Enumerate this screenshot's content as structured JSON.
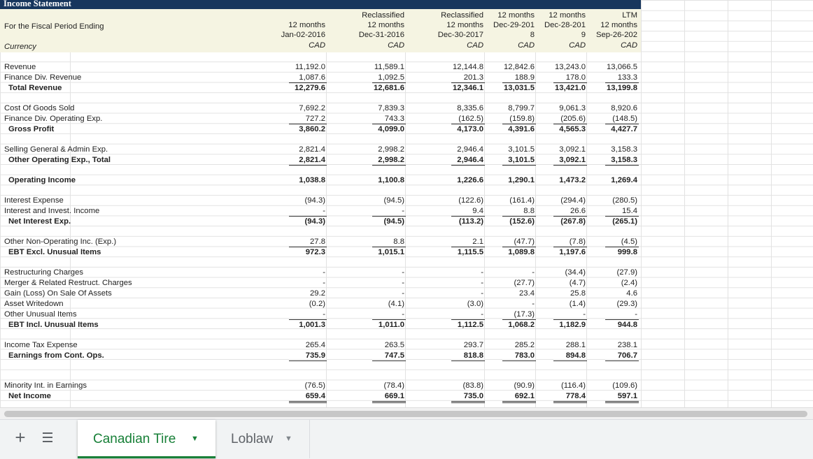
{
  "sheet": {
    "title": "Income Statement",
    "period_label": "For the Fiscal Period Ending",
    "currency_label": "Currency",
    "columns": [
      {
        "l1": "",
        "l2": "12 months",
        "l3": "Jan-02-2016",
        "cur": "CAD"
      },
      {
        "l1": "Reclassified",
        "l2": "12 months",
        "l3": "Dec-31-2016",
        "cur": "CAD"
      },
      {
        "l1": "Reclassified",
        "l2": "12 months",
        "l3": "Dec-30-2017",
        "cur": "CAD"
      },
      {
        "l1": "12 months",
        "l2": "Dec-29-201",
        "l3": "8",
        "cur": "CAD"
      },
      {
        "l1": "12 months",
        "l2": "Dec-28-201",
        "l3": "9",
        "cur": "CAD"
      },
      {
        "l1": "LTM",
        "l2": "12 months",
        "l3": "Sep-26-202",
        "cur": "CAD"
      }
    ],
    "rows": [
      {
        "label": "Revenue",
        "vals": [
          "11,192.0",
          "11,589.1",
          "12,144.8",
          "12,842.6",
          "13,243.0",
          "13,066.5"
        ]
      },
      {
        "label": "Finance Div. Revenue",
        "vals": [
          "1,087.6",
          "1,092.5",
          "201.3",
          "188.9",
          "178.0",
          "133.3"
        ]
      },
      {
        "label": "Total Revenue",
        "bold": true,
        "vals": [
          "12,279.6",
          "12,681.6",
          "12,346.1",
          "13,031.5",
          "13,421.0",
          "13,199.8"
        ]
      },
      {
        "label": "Cost Of Goods Sold",
        "vals": [
          "7,692.2",
          "7,839.3",
          "8,335.6",
          "8,799.7",
          "9,061.3",
          "8,920.6"
        ]
      },
      {
        "label": "Finance Div. Operating Exp.",
        "vals": [
          "727.2",
          "743.3",
          "(162.5)",
          "(159.8)",
          "(205.6)",
          "(148.5)"
        ]
      },
      {
        "label": "Gross Profit",
        "bold": true,
        "vals": [
          "3,860.2",
          "4,099.0",
          "4,173.0",
          "4,391.6",
          "4,565.3",
          "4,427.7"
        ]
      },
      {
        "label": "Selling General & Admin Exp.",
        "vals": [
          "2,821.4",
          "2,998.2",
          "2,946.4",
          "3,101.5",
          "3,092.1",
          "3,158.3"
        ]
      },
      {
        "label": "Other Operating Exp., Total",
        "bold": true,
        "vals": [
          "2,821.4",
          "2,998.2",
          "2,946.4",
          "3,101.5",
          "3,092.1",
          "3,158.3"
        ]
      },
      {
        "label": "Operating Income",
        "bold": true,
        "vals": [
          "1,038.8",
          "1,100.8",
          "1,226.6",
          "1,290.1",
          "1,473.2",
          "1,269.4"
        ]
      },
      {
        "label": "Interest Expense",
        "vals": [
          "(94.3)",
          "(94.5)",
          "(122.6)",
          "(161.4)",
          "(294.4)",
          "(280.5)"
        ]
      },
      {
        "label": "Interest and Invest. Income",
        "vals": [
          "-",
          "-",
          "9.4",
          "8.8",
          "26.6",
          "15.4"
        ]
      },
      {
        "label": "Net Interest Exp.",
        "bold": true,
        "vals": [
          "(94.3)",
          "(94.5)",
          "(113.2)",
          "(152.6)",
          "(267.8)",
          "(265.1)"
        ]
      },
      {
        "label": "Other Non-Operating Inc. (Exp.)",
        "vals": [
          "27.8",
          "8.8",
          "2.1",
          "(47.7)",
          "(7.8)",
          "(4.5)"
        ]
      },
      {
        "label": "EBT Excl. Unusual Items",
        "bold": true,
        "vals": [
          "972.3",
          "1,015.1",
          "1,115.5",
          "1,089.8",
          "1,197.6",
          "999.8"
        ]
      },
      {
        "label": "Restructuring Charges",
        "vals": [
          "-",
          "-",
          "-",
          "-",
          "(34.4)",
          "(27.9)"
        ]
      },
      {
        "label": "Merger & Related Restruct. Charges",
        "vals": [
          "-",
          "-",
          "-",
          "(27.7)",
          "(4.7)",
          "(2.4)"
        ]
      },
      {
        "label": "Gain (Loss) On Sale Of Assets",
        "vals": [
          "29.2",
          "-",
          "-",
          "23.4",
          "25.8",
          "4.6"
        ]
      },
      {
        "label": "Asset Writedown",
        "vals": [
          "(0.2)",
          "(4.1)",
          "(3.0)",
          "-",
          "(1.4)",
          "(29.3)"
        ]
      },
      {
        "label": "Other Unusual Items",
        "vals": [
          "-",
          "-",
          "-",
          "(17.3)",
          "-",
          "-"
        ]
      },
      {
        "label": "EBT Incl. Unusual Items",
        "bold": true,
        "vals": [
          "1,001.3",
          "1,011.0",
          "1,112.5",
          "1,068.2",
          "1,182.9",
          "944.8"
        ]
      },
      {
        "label": "Income Tax Expense",
        "vals": [
          "265.4",
          "263.5",
          "293.7",
          "285.2",
          "288.1",
          "238.1"
        ]
      },
      {
        "label": "Earnings from Cont. Ops.",
        "bold": true,
        "vals": [
          "735.9",
          "747.5",
          "818.8",
          "783.0",
          "894.8",
          "706.7"
        ]
      },
      {
        "label": "Minority Int. in Earnings",
        "vals": [
          "(76.5)",
          "(78.4)",
          "(83.8)",
          "(90.9)",
          "(116.4)",
          "(109.6)"
        ]
      },
      {
        "label": "Net Income",
        "bold": true,
        "vals": [
          "659.4",
          "669.1",
          "735.0",
          "692.1",
          "778.4",
          "597.1"
        ]
      }
    ]
  },
  "tabs": {
    "add_icon": "plus-icon",
    "list_icon": "menu-icon",
    "items": [
      {
        "label": "Canadian Tire",
        "active": true
      },
      {
        "label": "Loblaw",
        "active": false
      }
    ]
  }
}
